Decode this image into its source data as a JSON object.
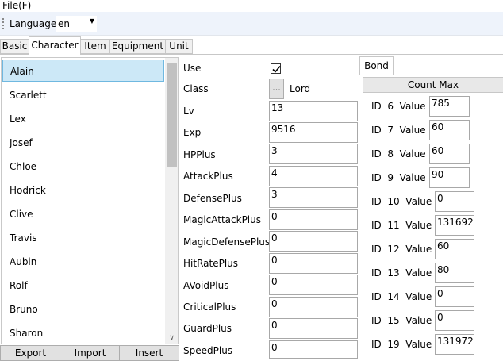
{
  "menu": {
    "file": "File(F)"
  },
  "toolbar": {
    "language_label": "Language",
    "language_value": "en"
  },
  "tabs": [
    {
      "label": "Basic"
    },
    {
      "label": "Character"
    },
    {
      "label": "Item"
    },
    {
      "label": "Equipment"
    },
    {
      "label": "Unit"
    }
  ],
  "characters": [
    {
      "name": "Alain"
    },
    {
      "name": "Scarlett"
    },
    {
      "name": "Lex"
    },
    {
      "name": "Josef"
    },
    {
      "name": "Chloe"
    },
    {
      "name": "Hodrick"
    },
    {
      "name": "Clive"
    },
    {
      "name": "Travis"
    },
    {
      "name": "Aubin"
    },
    {
      "name": "Rolf"
    },
    {
      "name": "Bruno"
    },
    {
      "name": "Sharon"
    }
  ],
  "list_buttons": {
    "export": "Export",
    "import": "Import",
    "insert": "Insert"
  },
  "form": {
    "use_label": "Use",
    "use_checked": true,
    "class_label": "Class",
    "class_button": "...",
    "class_value": "Lord",
    "fields": [
      {
        "label": "Lv",
        "value": "13"
      },
      {
        "label": "Exp",
        "value": "9516"
      },
      {
        "label": "HPPlus",
        "value": "3"
      },
      {
        "label": "AttackPlus",
        "value": "4"
      },
      {
        "label": "DefensePlus",
        "value": "3"
      },
      {
        "label": "MagicAttackPlus",
        "value": "0"
      },
      {
        "label": "MagicDefensePlus",
        "value": "0"
      },
      {
        "label": "HitRatePlus",
        "value": "0"
      },
      {
        "label": "AVoidPlus",
        "value": "0"
      },
      {
        "label": "CriticalPlus",
        "value": "0"
      },
      {
        "label": "GuardPlus",
        "value": "0"
      },
      {
        "label": "SpeedPlus",
        "value": "0"
      }
    ]
  },
  "bond": {
    "tab": "Bond",
    "header": "Count Max",
    "rows": [
      {
        "label": "ID  6  Value",
        "value": "785"
      },
      {
        "label": "ID  7  Value",
        "value": "60"
      },
      {
        "label": "ID  8  Value",
        "value": "60"
      },
      {
        "label": "ID  9  Value",
        "value": "90"
      },
      {
        "label": "ID  10  Value",
        "value": "0"
      },
      {
        "label": "ID  11  Value",
        "value": "131692"
      },
      {
        "label": "ID  12  Value",
        "value": "60"
      },
      {
        "label": "ID  13  Value",
        "value": "80"
      },
      {
        "label": "ID  14  Value",
        "value": "0"
      },
      {
        "label": "ID  15  Value",
        "value": "0"
      },
      {
        "label": "ID  19  Value",
        "value": "131972"
      }
    ]
  }
}
